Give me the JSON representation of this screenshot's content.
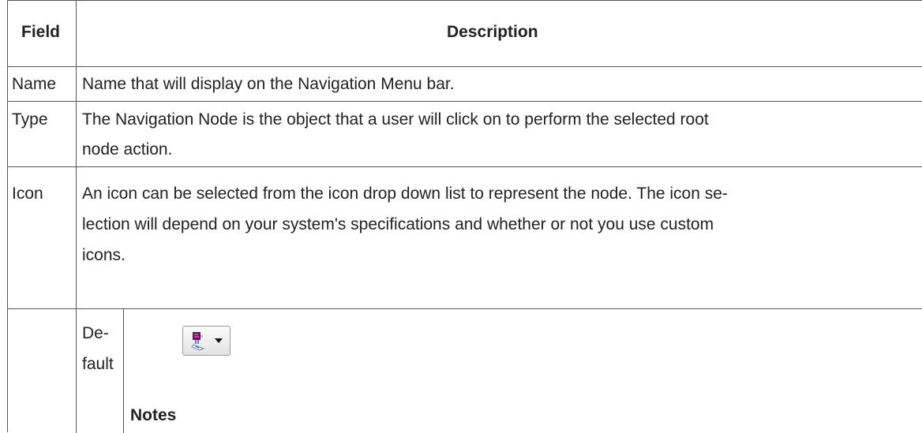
{
  "table": {
    "header": {
      "field": "Field",
      "description": "Description"
    },
    "rows": [
      {
        "field": "Name",
        "description": [
          "Name that will display on the Navigation Menu bar."
        ]
      },
      {
        "field": "Type",
        "description": [
          "The Navigation Node is the object that a user will click on to perform the selected root",
          "node action."
        ]
      },
      {
        "field": "Icon",
        "description": [
          "An icon can be selected from the icon drop down list to represent the node. The icon se-",
          "lection will depend on your system's specifications and whether or not you use custom",
          "icons."
        ]
      }
    ],
    "sub": {
      "label_line1": "De-",
      "label_line2": "fault",
      "icon_name": "navigation-node-icon",
      "notes_label": "Notes"
    }
  }
}
